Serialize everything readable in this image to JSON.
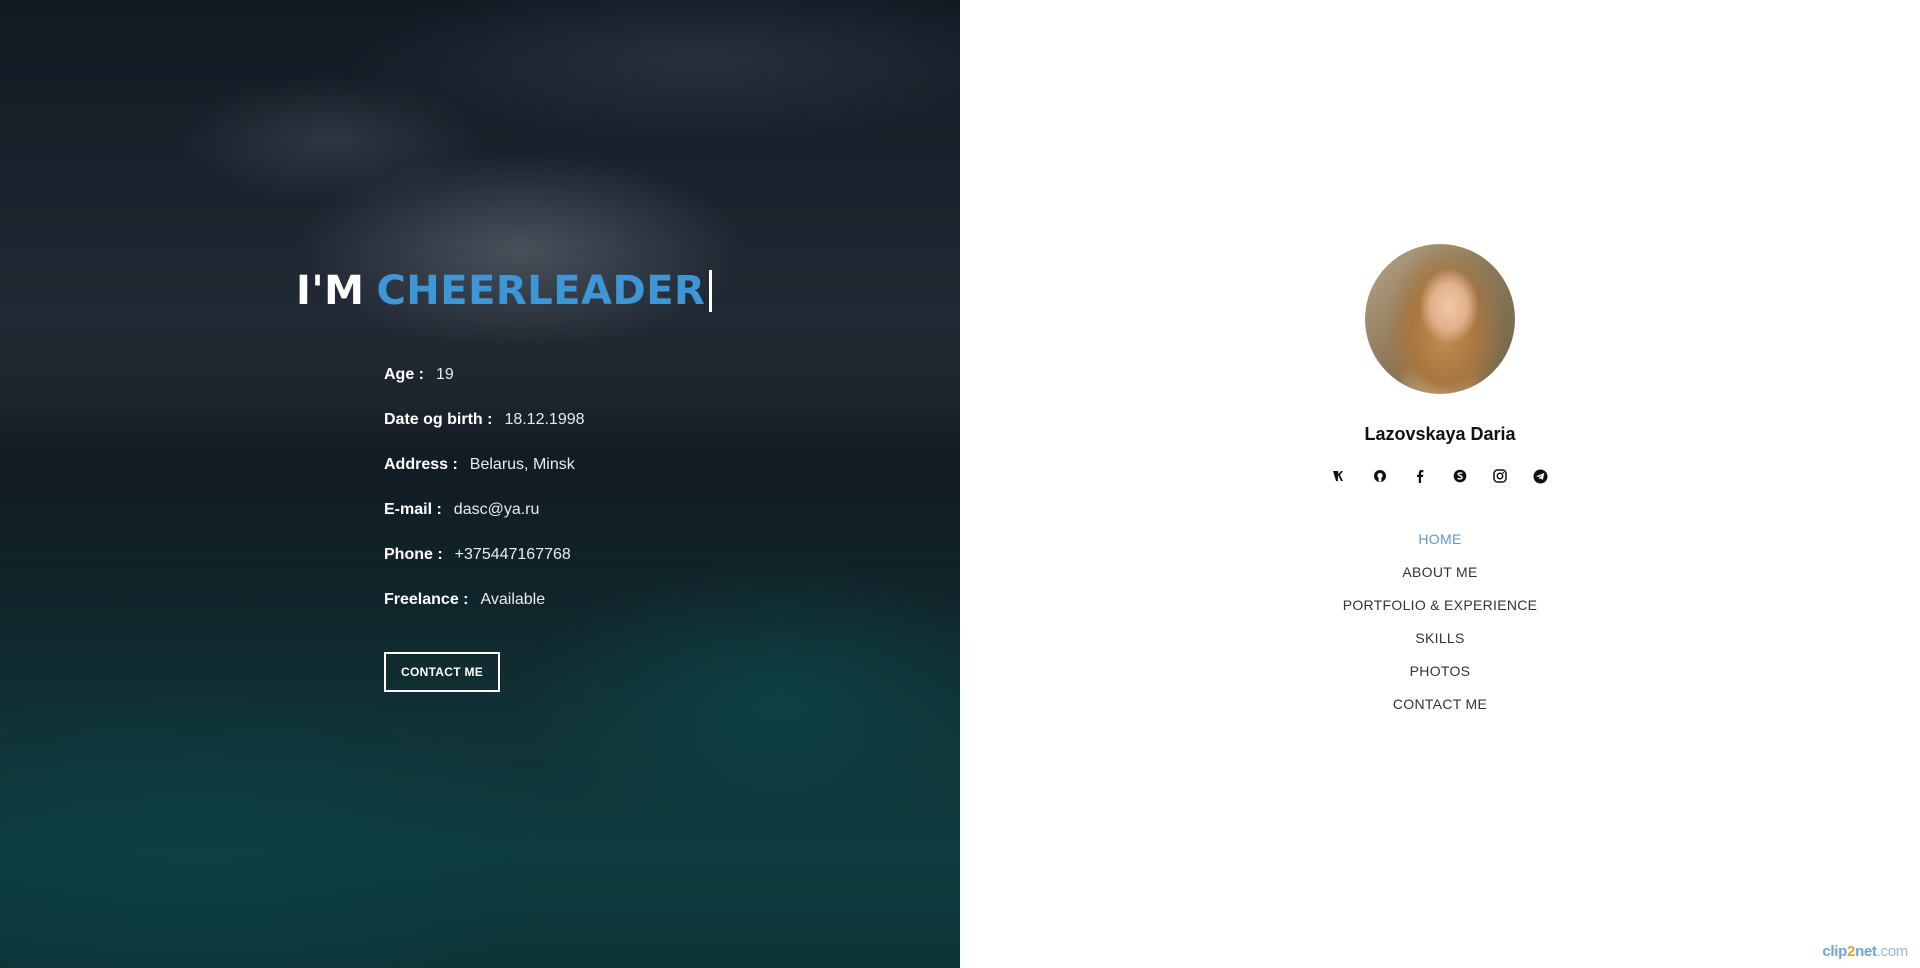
{
  "hero": {
    "headline_prefix": "I'M",
    "headline_role": "CHEERLEADER",
    "info": [
      {
        "label": "Age :",
        "value": "19"
      },
      {
        "label": "Date og birth :",
        "value": "18.12.1998"
      },
      {
        "label": "Address :",
        "value": "Belarus, Minsk"
      },
      {
        "label": "E-mail :",
        "value": "dasc@ya.ru"
      },
      {
        "label": "Phone :",
        "value": "+375447167768"
      },
      {
        "label": "Freelance :",
        "value": "Available"
      }
    ],
    "contact_button": "CONTACT ME"
  },
  "sidebar": {
    "name": "Lazovskaya Daria",
    "socials": [
      {
        "icon": "vk-icon",
        "glyph": "vk"
      },
      {
        "icon": "github-icon",
        "glyph": "gh"
      },
      {
        "icon": "facebook-icon",
        "glyph": "f"
      },
      {
        "icon": "skype-icon",
        "glyph": "S"
      },
      {
        "icon": "instagram-icon",
        "glyph": "ig"
      },
      {
        "icon": "telegram-icon",
        "glyph": "tg"
      }
    ],
    "nav": [
      {
        "label": "HOME",
        "active": true
      },
      {
        "label": "ABOUT ME",
        "active": false
      },
      {
        "label": "PORTFOLIO & EXPERIENCE",
        "active": false
      },
      {
        "label": "SKILLS",
        "active": false
      },
      {
        "label": "PHOTOS",
        "active": false
      },
      {
        "label": "CONTACT ME",
        "active": false
      }
    ]
  },
  "watermark": {
    "part1": "clip",
    "part2": "2",
    "part3": "net",
    "part4": ".com"
  },
  "colors": {
    "accent": "#3f96d6",
    "nav_active": "#5b9bd5"
  }
}
